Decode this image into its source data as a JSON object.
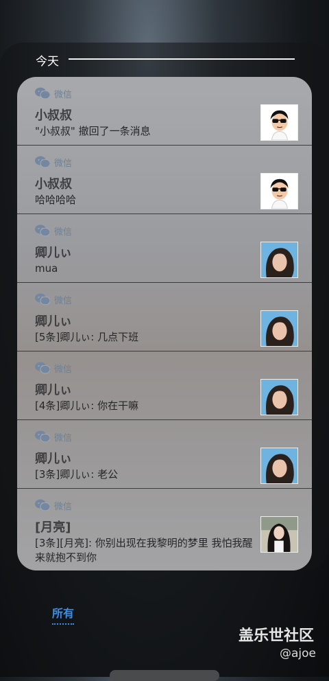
{
  "header": {
    "label": "今天"
  },
  "notifications": [
    {
      "app": "微信",
      "title": "小叔叔",
      "message": "\"小叔叔\" 撤回了一条消息",
      "avatar": "cartoon-avatar"
    },
    {
      "app": "微信",
      "title": "小叔叔",
      "message": "哈哈哈哈",
      "avatar": "cartoon-avatar"
    },
    {
      "app": "微信",
      "title": "卿儿ぃ",
      "message": "mua",
      "avatar": "girl-photo"
    },
    {
      "app": "微信",
      "title": "卿儿ぃ",
      "message": "[5条]卿儿ぃ: 几点下班",
      "avatar": "girl-photo"
    },
    {
      "app": "微信",
      "title": "卿儿ぃ",
      "message": "[4条]卿儿ぃ: 你在干嘛",
      "avatar": "girl-photo"
    },
    {
      "app": "微信",
      "title": "卿儿ぃ",
      "message": "[3条]卿儿ぃ: 老公",
      "avatar": "girl-photo"
    },
    {
      "app": "微信",
      "title": "[月亮]",
      "message": "[3条][月亮]: 你别出现在我黎明的梦里 我怕我醒来就抱不到你",
      "avatar": "woman-photo"
    }
  ],
  "bottom_tab": {
    "label": "所有",
    "color": "#3a8fe6"
  },
  "watermark": {
    "title": "盖乐世社区",
    "handle": "@ajoe"
  }
}
